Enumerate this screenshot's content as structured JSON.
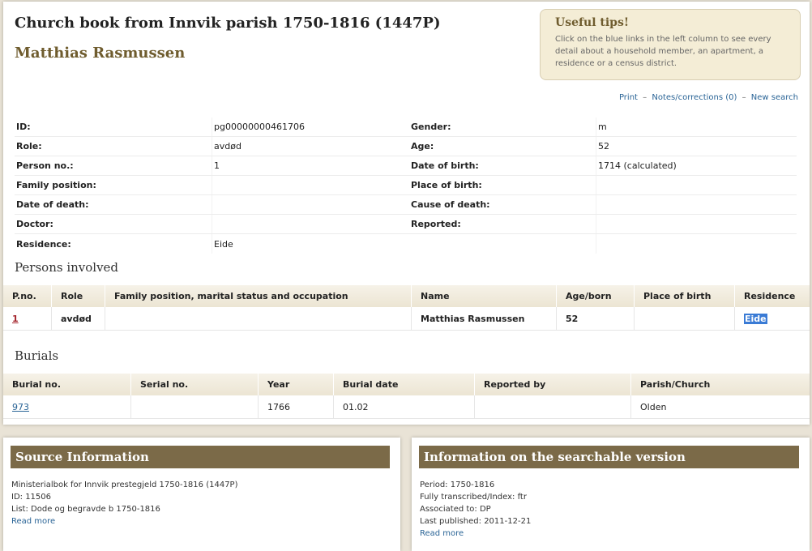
{
  "header": {
    "title": "Church book from Innvik parish 1750-1816 (1447P)",
    "person_name": "Matthias Rasmussen"
  },
  "tips": {
    "title": "Useful tips!",
    "text": "Click on the blue links in the left column to see every detail about a household member, an apartment, a residence or a census district."
  },
  "links": {
    "print": "Print",
    "notes": "Notes/corrections (0)",
    "new_search": "New search",
    "separator": "–"
  },
  "details": [
    {
      "label1": "ID:",
      "value1": "pg00000000461706",
      "label2": "Gender:",
      "value2": "m"
    },
    {
      "label1": "Role:",
      "value1": "avdød",
      "label2": "Age:",
      "value2": "52"
    },
    {
      "label1": "Person no.:",
      "value1": "1",
      "label2": "Date of birth:",
      "value2": "1714 (calculated)"
    },
    {
      "label1": "Family position:",
      "value1": "",
      "label2": "Place of birth:",
      "value2": ""
    },
    {
      "label1": "Date of death:",
      "value1": "",
      "label2": "Cause of death:",
      "value2": ""
    },
    {
      "label1": "Doctor:",
      "value1": "",
      "label2": "Reported:",
      "value2": ""
    },
    {
      "label1": "Residence:",
      "value1": "Eide",
      "label2": "",
      "value2": ""
    }
  ],
  "persons": {
    "heading": "Persons involved",
    "columns": [
      "P.no.",
      "Role",
      "Family position, marital status and occupation",
      "Name",
      "Age/born",
      "Place of birth",
      "Residence"
    ],
    "rows": [
      {
        "pno": "1",
        "role": "avdød",
        "family": "",
        "name": "Matthias Rasmussen",
        "age": "52",
        "birthplace": "",
        "residence": "Eide"
      }
    ]
  },
  "burials": {
    "heading": "Burials",
    "columns": [
      "Burial no.",
      "Serial no.",
      "Year",
      "Burial date",
      "Reported by",
      "Parish/Church"
    ],
    "rows": [
      {
        "burial_no": "973",
        "serial_no": "",
        "year": "1766",
        "date": "01.02",
        "reported_by": "",
        "parish": "Olden"
      }
    ]
  },
  "source": {
    "heading": "Source Information",
    "line1": "Ministerialbok for Innvik prestegjeld 1750-1816 (1447P)",
    "line2": "ID: 11506",
    "line3": "List: Dode og begravde b 1750-1816",
    "read_more": "Read more"
  },
  "searchable": {
    "heading": "Information on the searchable version",
    "line1": "Period: 1750-1816",
    "line2": "Fully transcribed/Index: ftr",
    "line3": "Associated to: DP",
    "line4": "Last published: 2011-12-21",
    "read_more": "Read more"
  }
}
